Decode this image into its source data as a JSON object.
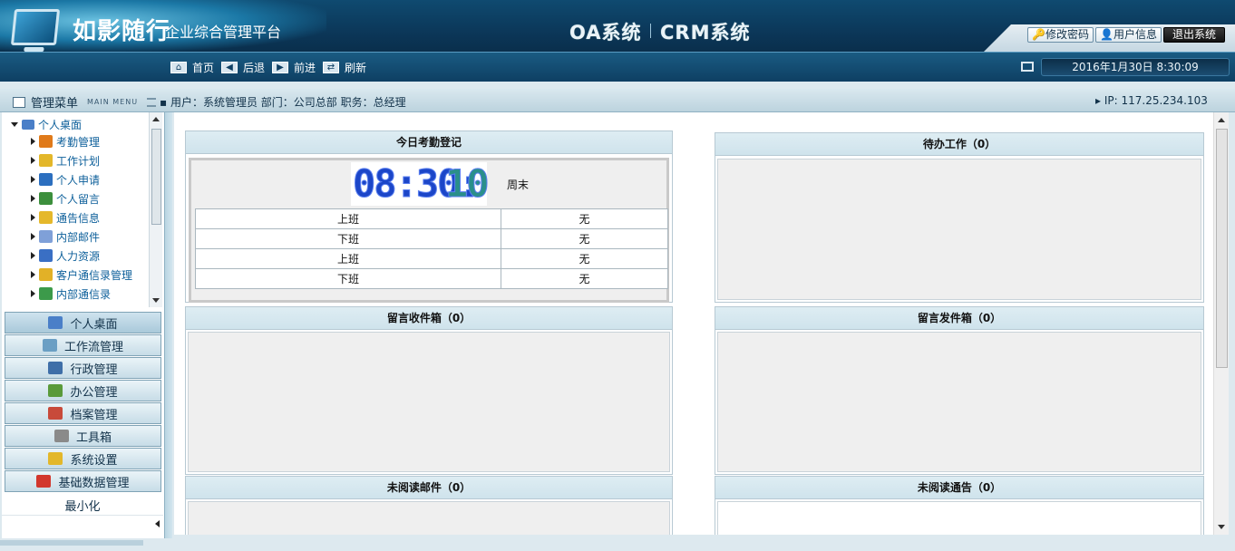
{
  "header": {
    "logo_title": "如影随行",
    "logo_subtitle": "企业综合管理平台",
    "system_oa": "OA系统",
    "system_crm": "CRM系统",
    "buttons": {
      "change_password": "修改密码",
      "user_info": "用户信息",
      "logout": "退出系统"
    }
  },
  "nav": {
    "home": "首页",
    "back": "后退",
    "forward": "前进",
    "refresh": "刷新",
    "datetime": "2016年1月30日 8:30:09"
  },
  "infobar": {
    "menu_title": "管理菜单",
    "menu_title_en": "MAIN MENU",
    "user_line": "用户：系统管理员 部门：公司总部 职务：总经理",
    "ip_line": "IP: 117.25.234.103"
  },
  "sidebar": {
    "tree_root": "个人桌面",
    "tree_items": [
      {
        "label": "考勤管理",
        "icon": "rss-icon",
        "color": "#e07a1a"
      },
      {
        "label": "工作计划",
        "icon": "pencil-icon",
        "color": "#e3b72a"
      },
      {
        "label": "个人申请",
        "icon": "user-icon",
        "color": "#2c6fbf"
      },
      {
        "label": "个人留言",
        "icon": "users-icon",
        "color": "#3c8f3c"
      },
      {
        "label": "通告信息",
        "icon": "notice-icon",
        "color": "#e5b82b"
      },
      {
        "label": "内部邮件",
        "icon": "mail-icon",
        "color": "#7fa0d8"
      },
      {
        "label": "人力资源",
        "icon": "person-icon",
        "color": "#3a6fc4"
      },
      {
        "label": "客户通信录管理",
        "icon": "book-icon",
        "color": "#e2b127"
      },
      {
        "label": "内部通信录",
        "icon": "contacts-icon",
        "color": "#3c9a4a"
      }
    ],
    "modules": [
      {
        "label": "个人桌面",
        "icon": "desktop-icon",
        "color": "#4a7fc8"
      },
      {
        "label": "工作流管理",
        "icon": "workflow-icon",
        "color": "#6b9fc4"
      },
      {
        "label": "行政管理",
        "icon": "admin-icon",
        "color": "#3f6fa8"
      },
      {
        "label": "办公管理",
        "icon": "office-icon",
        "color": "#5a9a3a"
      },
      {
        "label": "档案管理",
        "icon": "archive-icon",
        "color": "#c84a3a"
      },
      {
        "label": "工具箱",
        "icon": "trash-icon",
        "color": "#8a8a8a"
      },
      {
        "label": "系统设置",
        "icon": "pencil-icon",
        "color": "#e3b72a"
      },
      {
        "label": "基础数据管理",
        "icon": "plug-icon",
        "color": "#d2372d"
      }
    ],
    "minimize": "最小化"
  },
  "panels": {
    "attendance": {
      "title": "今日考勤登记",
      "clock_hm": "08:30:",
      "clock_s": "10",
      "weekday": "周末",
      "rows": [
        {
          "label": "上班",
          "value": "无"
        },
        {
          "label": "下班",
          "value": "无"
        },
        {
          "label": "上班",
          "value": "无"
        },
        {
          "label": "下班",
          "value": "无"
        }
      ]
    },
    "todo": "待办工作（0）",
    "inbox": "留言收件箱（0）",
    "outbox": "留言发件箱（0）",
    "unread_mail": "未阅读邮件（0）",
    "unread_notice": "未阅读通告（0）"
  }
}
